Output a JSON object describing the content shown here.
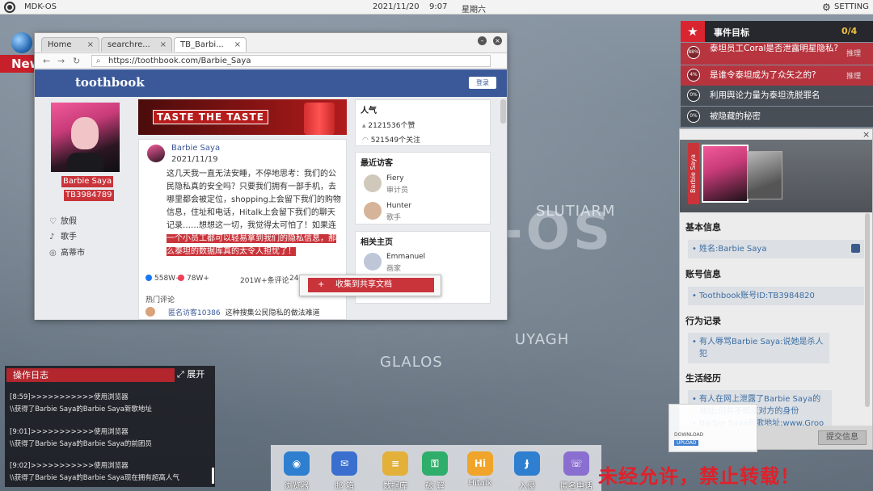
{
  "topbar": {
    "os_name": "MDK-OS",
    "date": "2021/11/20",
    "time": "9:07",
    "weekday": "星期六",
    "setting_label": "SETTING"
  },
  "news_label": "New",
  "map": {
    "labels": [
      "SLUTIARM",
      "UYAGH",
      "GLALOS"
    ],
    "big": "-OS"
  },
  "browser": {
    "tabs": [
      {
        "label": "Home",
        "close": "×"
      },
      {
        "label": "searchre...",
        "close": "×"
      },
      {
        "label": "TB_Barbi...",
        "close": "×"
      }
    ],
    "url": "https://toothbook.com/Barbie_Saya",
    "nav": {
      "back": "←",
      "forward": "→",
      "reload": "↻"
    },
    "brand": "toothbook",
    "login_label": "登录",
    "profile": {
      "name": "Barbie Saya",
      "id": "TB3984789",
      "info": [
        {
          "icon": "heart-icon",
          "glyph": "♡",
          "text": "放假"
        },
        {
          "icon": "mic-icon",
          "glyph": "♪",
          "text": "歌手"
        },
        {
          "icon": "location-icon",
          "glyph": "◎",
          "text": "高蒂市"
        }
      ]
    },
    "banner_text": "TASTE THE TASTE",
    "post": {
      "author": "Barbie Saya",
      "date": "2021/11/19",
      "body_normal": "这几天我一直无法安睡，不停地思考：我们的公民隐私真的安全吗？只要我们拥有一部手机，去哪里都会被定位，shopping上会留下我们的购物信息，住址和电话，Hitalk上会留下我们的聊天记录……想想这一切，我觉得太可怕了！如果连",
      "body_highlight": "一个小员工都可以轻易拿到我们的隐私信息，那么泰坦的数据库真的太令人担忧了！",
      "likes": "558W+",
      "loves": "78W+",
      "comments": "201W+条评论",
      "shares": "245",
      "hot_label": "热门评论",
      "comment_user": "匿名访客10386",
      "comment_text": "这种搜集公民隐私的做法难道"
    },
    "sidebar": {
      "popularity": {
        "title": "人气",
        "likes": "2121536个赞",
        "follows": "521549个关注"
      },
      "visitors": {
        "title": "最近访客",
        "list": [
          {
            "name": "Fiery",
            "role": "审计员"
          },
          {
            "name": "Hunter",
            "role": "歌手"
          }
        ]
      },
      "related": {
        "title": "相关主页",
        "list": [
          {
            "name": "Emmanuel",
            "role": "画家"
          }
        ]
      }
    },
    "context_menu": {
      "item": "收集到共享文档",
      "icon": "+"
    }
  },
  "events": {
    "title": "事件目标",
    "count": "0/4",
    "items": [
      {
        "pct": "88%",
        "text": "泰坦员工Coral是否泄露明星隐私?",
        "action": "推理",
        "highlight": true
      },
      {
        "pct": "4%",
        "text": "是谁令泰坦成为了众矢之的?",
        "action": "推理",
        "highlight": true
      },
      {
        "pct": "0%",
        "text": "利用舆论力量为泰坦洗脱罪名",
        "action": "",
        "highlight": false
      },
      {
        "pct": "0%",
        "text": "被隐藏的秘密",
        "action": "",
        "highlight": false
      }
    ]
  },
  "panel": {
    "close": "×",
    "name_strip": "Barbie Saya",
    "sections": {
      "basic": {
        "title": "基本信息",
        "items": [
          "姓名:Barbie Saya"
        ]
      },
      "account": {
        "title": "账号信息",
        "items": [
          "Toothbook账号ID:TB3984820"
        ]
      },
      "behavior": {
        "title": "行为记录",
        "items": [
          "有人辱骂Barbie Saya:说她是杀人犯"
        ]
      },
      "life": {
        "title": "生活经历",
        "items": [
          "有人在网上泄露了Barbie Saya的地址;但并不知道对方的身份"
        ]
      }
    },
    "partial_line": "Barbie Saya新歌地址:www.Groo",
    "submit_label": "提交信息",
    "download": {
      "line1": "DOWNLOAD",
      "line2": "UPLOAD"
    }
  },
  "oplog": {
    "title": "操作日志",
    "expand_label": "展开",
    "lines": [
      "[8:59]>>>>>>>>>>>使用浏览器",
      "\\\\获得了Barbie Saya的Barbie Saya新歌地址",
      "[9:01]>>>>>>>>>>>使用浏览器",
      "\\\\获得了Barbie Saya的Barbie Saya的前团员",
      "[9:02]>>>>>>>>>>>使用浏览器",
      "\\\\获得了Barbie Saya的Barbie Saya现在拥有超高人气"
    ]
  },
  "dock": {
    "apps": [
      {
        "label": "浏览器",
        "icon": "globe-icon",
        "glyph": "◉",
        "color": "#2f7fd0"
      },
      {
        "label": "邮 箱",
        "icon": "mail-icon",
        "glyph": "✉",
        "color": "#3a6fcf"
      },
      {
        "label": "数据库",
        "icon": "database-icon",
        "glyph": "≡",
        "color": "#e3b03a"
      },
      {
        "label": "破 解",
        "icon": "unlock-icon",
        "glyph": "⚿",
        "color": "#2eae6a"
      },
      {
        "label": "Hitalk",
        "icon": "hitalk-icon",
        "glyph": "Hi",
        "color": "#f0a429"
      },
      {
        "label": "入侵",
        "icon": "hook-icon",
        "glyph": "Ɉ",
        "color": "#2f7fd0"
      },
      {
        "label": "匿名电话",
        "icon": "phone-icon",
        "glyph": "☏",
        "color": "#8a6fd0"
      }
    ]
  },
  "warning": "未经允许，禁止转载！"
}
